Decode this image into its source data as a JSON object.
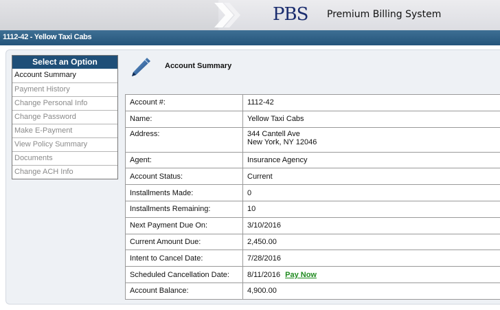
{
  "header": {
    "logo": "PBS",
    "tagline": "Premium Billing System"
  },
  "titlebar": {
    "text": "1112-42 - Yellow Taxi Cabs"
  },
  "sidebar": {
    "heading": "Select an Option",
    "items": [
      {
        "label": "Account Summary",
        "active": true
      },
      {
        "label": "Payment History",
        "active": false
      },
      {
        "label": "Change Personal Info",
        "active": false
      },
      {
        "label": "Change Password",
        "active": false
      },
      {
        "label": "Make E-Payment",
        "active": false
      },
      {
        "label": "View Policy Summary",
        "active": false
      },
      {
        "label": "Documents",
        "active": false
      },
      {
        "label": "Change ACH Info",
        "active": false
      }
    ]
  },
  "main": {
    "section_title": "Account Summary",
    "section_icon": "pen-icon",
    "rows": [
      {
        "label": "Account #:",
        "value": "1112-42"
      },
      {
        "label": "Name:",
        "value": "Yellow Taxi Cabs"
      },
      {
        "label": "Address:",
        "value": "344 Cantell Ave",
        "value2": "New York, NY 12046"
      },
      {
        "label": "Agent:",
        "value": "Insurance Agency"
      },
      {
        "label": "Account Status:",
        "value": "Current"
      },
      {
        "label": "Installments Made:",
        "value": "0"
      },
      {
        "label": "Installments Remaining:",
        "value": "10"
      },
      {
        "label": "Next Payment Due On:",
        "value": "3/10/2016"
      },
      {
        "label": "Current Amount Due:",
        "value": "2,450.00"
      },
      {
        "label": "Intent to Cancel Date:",
        "value": "7/28/2016"
      },
      {
        "label": "Scheduled Cancellation Date:",
        "value": "8/11/2016",
        "link": "Pay Now"
      },
      {
        "label": "Account Balance:",
        "value": "4,900.00"
      }
    ]
  },
  "colors": {
    "titlebar": "#2d5f86",
    "sidebar_heading": "#1f4f78",
    "link": "#1e8a1e",
    "logo": "#1a2c6e"
  }
}
